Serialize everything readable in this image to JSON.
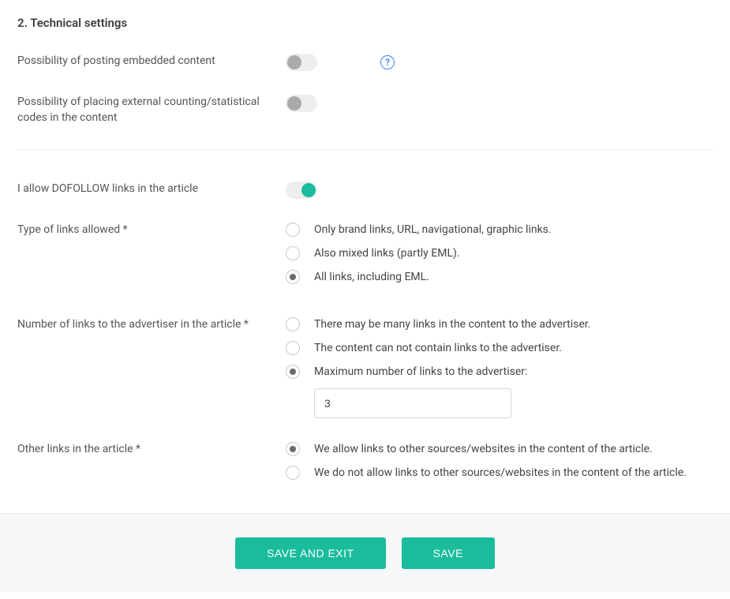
{
  "section_title": "2. Technical settings",
  "embedded": {
    "label": "Possibility of posting embedded content",
    "on": false
  },
  "external_codes": {
    "label": "Possibility of placing external counting/statistical codes in the content",
    "on": false
  },
  "dofollow": {
    "label": "I allow DOFOLLOW links in the article",
    "on": true
  },
  "link_types": {
    "label": "Type of links allowed *",
    "options": [
      "Only brand links, URL, navigational, graphic links.",
      "Also mixed links (partly EML).",
      "All links, including EML."
    ],
    "selected": 2
  },
  "num_links": {
    "label": "Number of links to the advertiser in the article *",
    "options": [
      "There may be many links in the content to the advertiser.",
      "The content can not contain links to the advertiser.",
      "Maximum number of links to the advertiser:"
    ],
    "selected": 2,
    "max_value": "3"
  },
  "other_links": {
    "label": "Other links in the article *",
    "options": [
      "We allow links to other sources/websites in the content of the article.",
      "We do not allow links to other sources/websites in the content of the article."
    ],
    "selected": 0
  },
  "buttons": {
    "save_exit": "SAVE AND EXIT",
    "save": "SAVE"
  }
}
